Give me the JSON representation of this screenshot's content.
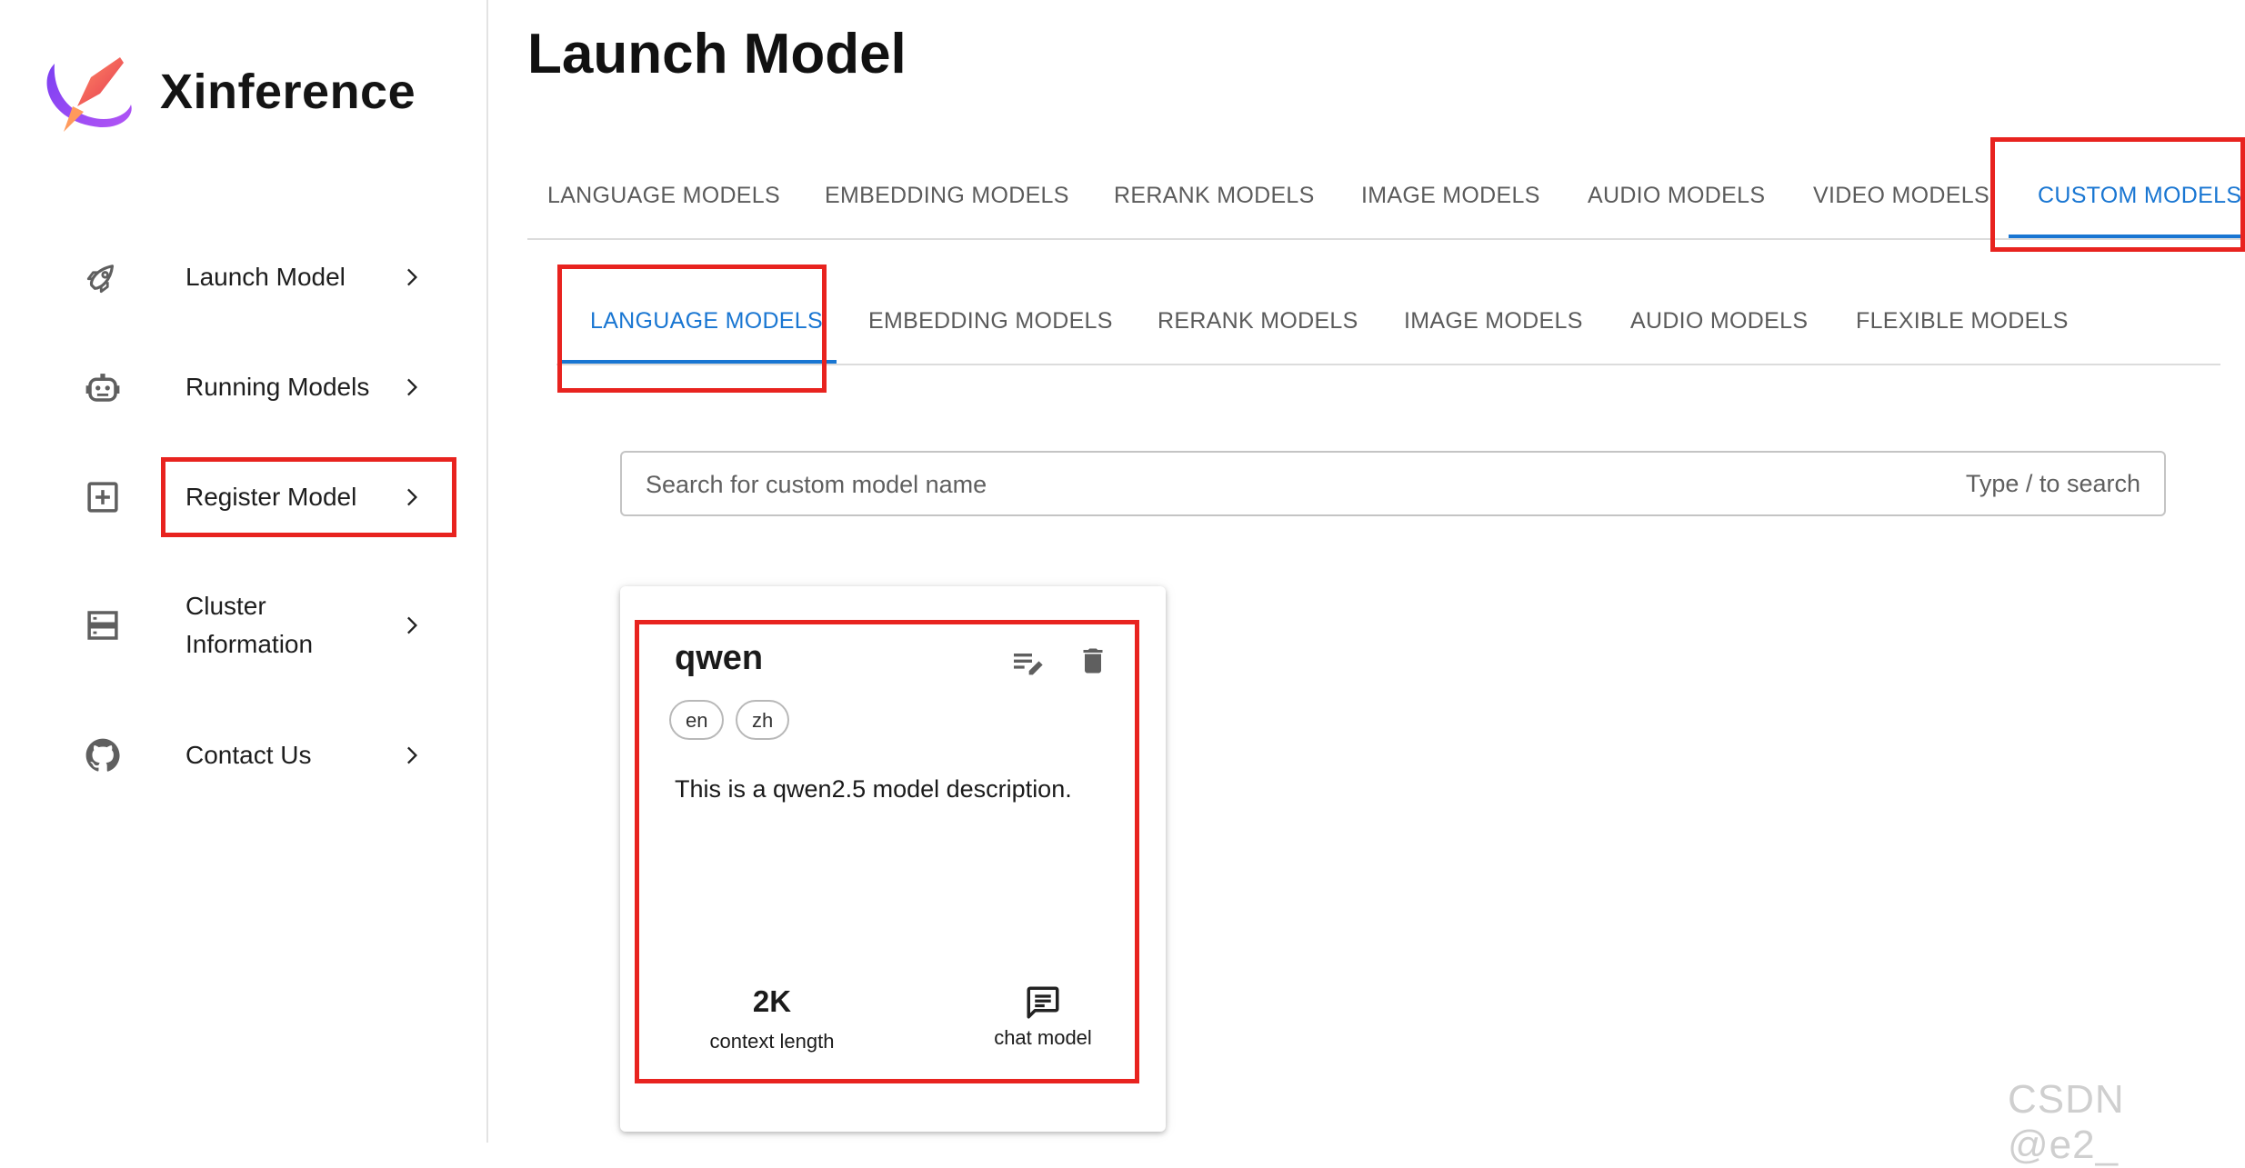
{
  "app": {
    "brand": "Xinference"
  },
  "sidebar": {
    "items": [
      {
        "label": "Launch Model",
        "icon": "rocket-icon"
      },
      {
        "label": "Running Models",
        "icon": "robot-icon"
      },
      {
        "label": "Register Model",
        "icon": "add-box-icon"
      },
      {
        "label_line1": "Cluster",
        "label_line2": "Information",
        "icon": "server-icon"
      },
      {
        "label": "Contact Us",
        "icon": "github-icon"
      }
    ]
  },
  "main": {
    "title": "Launch Model",
    "tabs": [
      {
        "label": "LANGUAGE MODELS"
      },
      {
        "label": "EMBEDDING MODELS"
      },
      {
        "label": "RERANK MODELS"
      },
      {
        "label": "IMAGE MODELS"
      },
      {
        "label": "AUDIO MODELS"
      },
      {
        "label": "VIDEO MODELS"
      },
      {
        "label": "CUSTOM MODELS",
        "active": true
      }
    ],
    "subtabs": [
      {
        "label": "LANGUAGE MODELS",
        "active": true
      },
      {
        "label": "EMBEDDING MODELS"
      },
      {
        "label": "RERANK MODELS"
      },
      {
        "label": "IMAGE MODELS"
      },
      {
        "label": "AUDIO MODELS"
      },
      {
        "label": "FLEXIBLE MODELS"
      }
    ],
    "search": {
      "placeholder": "Search for custom model name",
      "value": "",
      "hint": "Type / to search"
    },
    "cards": [
      {
        "name": "qwen",
        "languages": [
          "en",
          "zh"
        ],
        "description": "This is a qwen2.5 model description.",
        "context_length": "2K",
        "context_length_label": "context length",
        "model_type_label": "chat model"
      }
    ]
  },
  "watermark": "CSDN @e2_",
  "colors": {
    "accent": "#1976d2",
    "highlight": "#e8231f",
    "text": "#1a1a1a",
    "muted": "#5b5b5b"
  }
}
